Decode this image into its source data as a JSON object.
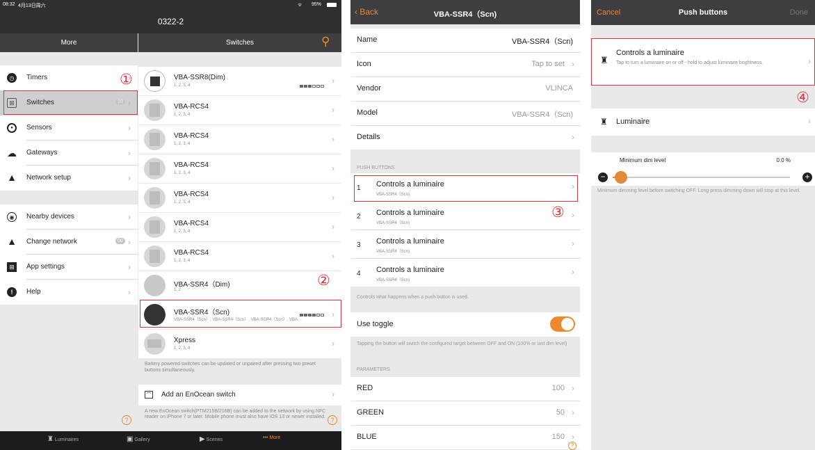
{
  "status_bar": {
    "time": "08:32",
    "date": "4月13日周六",
    "battery": "95%"
  },
  "app_title": "0322-2",
  "more_panel": {
    "title": "More",
    "items": [
      {
        "label": "Timers",
        "icon": "clock-icon"
      },
      {
        "label": "Switches",
        "icon": "switch-icon",
        "badge": "10"
      },
      {
        "label": "Sensors",
        "icon": "sensor-icon"
      },
      {
        "label": "Gateways",
        "icon": "gateway-icon"
      },
      {
        "label": "Network setup",
        "icon": "network-icon"
      },
      {
        "label": "Nearby devices",
        "icon": "nearby-icon"
      },
      {
        "label": "Change network",
        "icon": "network-icon",
        "badge": "00"
      },
      {
        "label": "App settings",
        "icon": "settings-icon"
      },
      {
        "label": "Help",
        "icon": "help-icon"
      }
    ]
  },
  "switches_panel": {
    "title": "Switches",
    "items": [
      {
        "name": "VBA-SSR8(Dim)",
        "sub": "1, 2, 3, 4",
        "signal": 3
      },
      {
        "name": "VBA-RCS4",
        "sub": "1, 2, 3, 4"
      },
      {
        "name": "VBA-RCS4",
        "sub": "1, 2, 3, 4"
      },
      {
        "name": "VBA-RCS4",
        "sub": "1, 2, 3, 4"
      },
      {
        "name": "VBA-RCS4",
        "sub": "1, 2, 3, 4"
      },
      {
        "name": "VBA-RCS4",
        "sub": "1, 2, 3, 4"
      },
      {
        "name": "VBA-RCS4",
        "sub": "1, 2, 3, 4"
      },
      {
        "name": "VBA-SSR4（Dim)",
        "sub": "1, 2"
      },
      {
        "name": "VBA-SSR4（Scn)",
        "sub": "VBA-SSR4（Scn）, VBA-SSR4（Scn）, VBA-SSR4（Scn）, VBA...",
        "signal": 4
      },
      {
        "name": "Xpress",
        "sub": "1, 2, 3, 4"
      }
    ],
    "battery_note": "Battery powered switches can be updated or unpaired after pressing two preset buttons simultaneously.",
    "add_label": "Add an EnOcean switch",
    "add_note": "A new EnOcean switch(PTM215B/216B) can be added to the network by using NFC reader on iPhone 7 or later. Mobile phone must also have iOS 13 or newer installed."
  },
  "tabbar": [
    {
      "label": "Luminaires",
      "icon": "luminaire-icon"
    },
    {
      "label": "Gallery",
      "icon": "gallery-icon"
    },
    {
      "label": "Scenes",
      "icon": "scenes-icon"
    },
    {
      "label": "More",
      "icon": "more-icon"
    }
  ],
  "device_panel": {
    "back": "Back",
    "title": "VBA-SSR4（Scn)",
    "rows": [
      {
        "label": "Name",
        "value": "VBA-SSR4（Scn)"
      },
      {
        "label": "Icon",
        "value": "Tap to set"
      },
      {
        "label": "Vendor",
        "value": "VLINCA"
      },
      {
        "label": "Model",
        "value": "VBA-SSR4（Scn)"
      },
      {
        "label": "Details",
        "value": ""
      }
    ],
    "push_header": "PUSH BUTTONS",
    "push_buttons": [
      {
        "num": "1",
        "label": "Controls a luminaire",
        "sub": "VBA-SSR4（Scn)"
      },
      {
        "num": "2",
        "label": "Controls a luminaire",
        "sub": "VBA-SSR4（Scn)"
      },
      {
        "num": "3",
        "label": "Controls a luminaire",
        "sub": "VBA-SSR4（Scn)"
      },
      {
        "num": "4",
        "label": "Controls a luminaire",
        "sub": "VBA-SSR4（Scn)"
      }
    ],
    "push_note": "Controls what happens when a push button is used.",
    "toggle_label": "Use toggle",
    "toggle_on": true,
    "toggle_note": "Tapping the button will switch the configured target between OFF and ON (100% or last dim level)",
    "params_header": "PARAMETERS",
    "params": [
      {
        "label": "RED",
        "value": "100"
      },
      {
        "label": "GREEN",
        "value": "50"
      },
      {
        "label": "BLUE",
        "value": "150"
      }
    ]
  },
  "push_panel": {
    "cancel": "Cancel",
    "title": "Push buttons",
    "done": "Done",
    "option_title": "Controls a luminaire",
    "option_desc": "Tap to turn a luminaire on or off - hold to adjust luminaire brightness.",
    "target": "Luminaire",
    "min_label": "Minimum dim level",
    "min_value": "0.0 %",
    "min_fraction": 0.0,
    "min_note": "Minimum dimming level before switching OFF. Long press dimming down will stop at this level."
  },
  "annotations": [
    "①",
    "②",
    "③",
    "④"
  ],
  "colors": {
    "accent": "#e98a2f",
    "highlight": "#d9343c",
    "dark_bar": "#2f2f31"
  }
}
